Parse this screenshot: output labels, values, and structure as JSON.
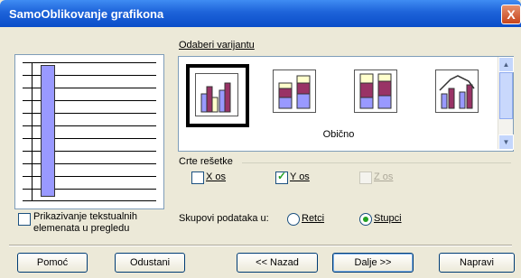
{
  "window": {
    "title": "SamoOblikovanje grafikona",
    "close_glyph": "X"
  },
  "variants": {
    "label": "Odaberi varijantu",
    "caption": "Obično",
    "items": [
      {
        "name": "column-normal",
        "selected": true
      },
      {
        "name": "column-stacked",
        "selected": false
      },
      {
        "name": "column-percent",
        "selected": false
      },
      {
        "name": "column-line",
        "selected": false
      }
    ]
  },
  "gridlines": {
    "label": "Crte rešetke",
    "x_axis": {
      "label": "X os",
      "checked": false,
      "enabled": true
    },
    "y_axis": {
      "label": "Y os",
      "checked": true,
      "enabled": true
    },
    "z_axis": {
      "label": "Z os",
      "checked": false,
      "enabled": false
    }
  },
  "preview_text": {
    "label_line1": "Prikazivanje tekstualnih",
    "label_line2": "elemenata u pregledu",
    "checked": false
  },
  "data_series": {
    "label": "Skupovi podataka u:",
    "rows_label": "Retci",
    "columns_label": "Stupci",
    "selected": "Stupci"
  },
  "buttons": {
    "help": "Pomoć",
    "cancel": "Odustani",
    "back": "<< Nazad",
    "next": "Dalje >>",
    "finish": "Napravi"
  }
}
